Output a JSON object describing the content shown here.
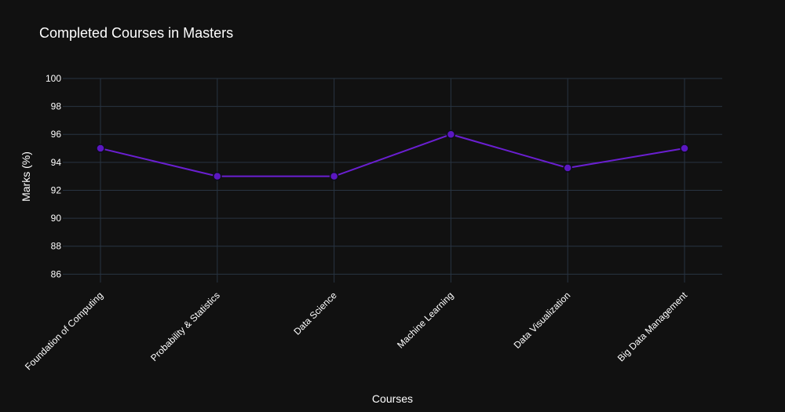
{
  "chart_data": {
    "type": "line",
    "title": "Completed Courses in Masters",
    "xlabel": "Courses",
    "ylabel": "Marks (%)",
    "categories": [
      "Foundation of Computing",
      "Probability & Statistics",
      "Data Science",
      "Machine Learning",
      "Data Visualization",
      "Big Data Management"
    ],
    "series": [
      {
        "values": [
          95,
          93,
          93,
          96,
          93.6,
          95
        ]
      }
    ],
    "ylim": [
      85.4,
      100
    ],
    "yticks": [
      86,
      88,
      90,
      92,
      94,
      96,
      98,
      100
    ],
    "grid": true,
    "legend": "none",
    "colors": {
      "background": "#111111",
      "grid": "#283442",
      "line": "#6a1fd1",
      "marker_fill": "#5b17c2",
      "marker_edge": "#0d0d1a",
      "text": "#ffffff"
    }
  }
}
